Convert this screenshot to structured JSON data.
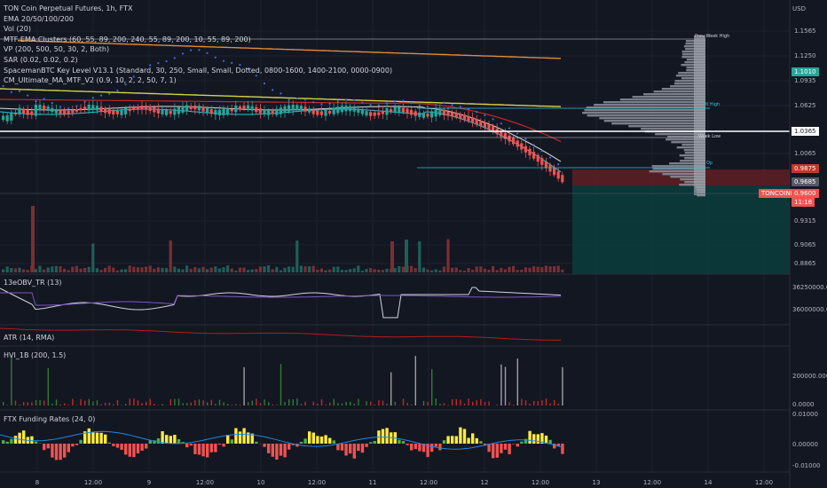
{
  "legend": {
    "title": "TON Coin Perpetual Futures, 1h, FTX",
    "indicators": [
      "EMA 20/50/100/200",
      "Vol (20)",
      "MTF EMA Clusters (60, 55, 89, 200, 240, 55, 89, 200, 10, 55, 89, 200)",
      "VP (200, 500, 50, 30, 2, Both)",
      "SAR (0.02, 0.02, 0.2)",
      "SpacemanBTC Key Level V13.1 (Standard, 30, 250, Small, Small, Dotted, 0800-1600, 1400-2100, 0000-0900)",
      "CM_Ultimate_MA_MTF_V2 (0.9, 10, 2, 2, 50, 7, 1)"
    ]
  },
  "panes": {
    "obv": "13eOBV_TR (13)",
    "atr": "ATR (14, RMA)",
    "hvi": "HVI_1B (200, 1.5)",
    "funding": "FTX Funding Rates (24, 0)"
  },
  "price_axis": {
    "currency": "USD",
    "ticks": [
      "1.1565",
      "1.1250",
      "1.0935",
      "1.0625",
      "1.0365",
      "1.0065",
      "0.9875",
      "0.9685",
      "0.9315",
      "0.9065",
      "0.8865"
    ],
    "badges": [
      {
        "text": "1.1010",
        "color": "#26a69a"
      },
      {
        "text": "1.0365",
        "color": "#ffffff"
      },
      {
        "text": "0.9875",
        "color": "#c0392b"
      },
      {
        "text": "0.9685",
        "color": "#555a64"
      },
      {
        "text": "TONCOINPERP",
        "color": "#ef5350"
      },
      {
        "text": "0.9600",
        "color": "#ef5350"
      },
      {
        "text": "11:18",
        "color": "#ef5350"
      }
    ],
    "obv_ticks": [
      "36250000.000",
      "36000000.000"
    ],
    "hvi_ticks": [
      "200000.0000",
      "0.0000"
    ],
    "funding_ticks": [
      "0.01000",
      "0.00000",
      "-0.01000"
    ]
  },
  "key_levels": {
    "prev_week_high": "Prev Week High",
    "high": "Hi High",
    "week_low": "Week Low",
    "open": "Op"
  },
  "time_axis": [
    "8",
    "12:00",
    "9",
    "12:00",
    "10",
    "12:00",
    "11",
    "12:00",
    "12",
    "12:00",
    "13",
    "12:00",
    "14",
    "12:00"
  ]
}
